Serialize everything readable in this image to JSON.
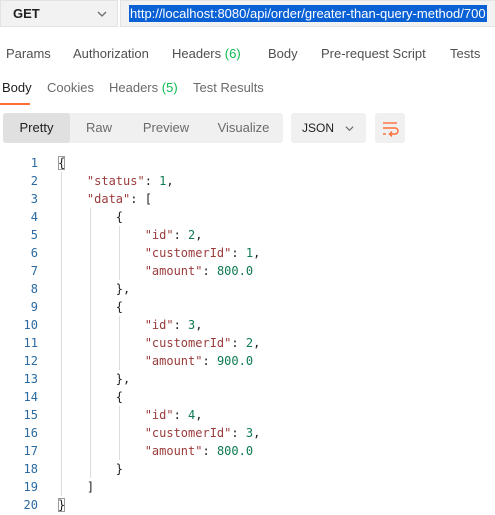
{
  "request": {
    "method": "GET",
    "url": "http://localhost:8080/api/order/greater-than-query-method/700"
  },
  "request_tabs": [
    {
      "label": "Params",
      "count": ""
    },
    {
      "label": "Authorization",
      "count": ""
    },
    {
      "label": "Headers",
      "count": "(6)"
    },
    {
      "label": "Body",
      "count": ""
    },
    {
      "label": "Pre-request Script",
      "count": ""
    },
    {
      "label": "Tests",
      "count": ""
    }
  ],
  "response_tabs": [
    {
      "label": "Body",
      "count": ""
    },
    {
      "label": "Cookies",
      "count": ""
    },
    {
      "label": "Headers",
      "count": "(5)"
    },
    {
      "label": "Test Results",
      "count": ""
    }
  ],
  "format_buttons": [
    "Pretty",
    "Raw",
    "Preview",
    "Visualize"
  ],
  "language": "JSON",
  "accent_color": "#ff6c37",
  "code_lines": [
    {
      "n": "1",
      "indent": 0,
      "parts": [
        [
          "punc",
          "{"
        ]
      ]
    },
    {
      "n": "2",
      "indent": 1,
      "parts": [
        [
          "key",
          "\"status\""
        ],
        [
          "punc",
          ": "
        ],
        [
          "num",
          "1"
        ],
        [
          "punc",
          ","
        ]
      ]
    },
    {
      "n": "3",
      "indent": 1,
      "parts": [
        [
          "key",
          "\"data\""
        ],
        [
          "punc",
          ": ["
        ]
      ]
    },
    {
      "n": "4",
      "indent": 2,
      "parts": [
        [
          "punc",
          "{"
        ]
      ]
    },
    {
      "n": "5",
      "indent": 3,
      "parts": [
        [
          "key",
          "\"id\""
        ],
        [
          "punc",
          ": "
        ],
        [
          "num",
          "2"
        ],
        [
          "punc",
          ","
        ]
      ]
    },
    {
      "n": "6",
      "indent": 3,
      "parts": [
        [
          "key",
          "\"customerId\""
        ],
        [
          "punc",
          ": "
        ],
        [
          "num",
          "1"
        ],
        [
          "punc",
          ","
        ]
      ]
    },
    {
      "n": "7",
      "indent": 3,
      "parts": [
        [
          "key",
          "\"amount\""
        ],
        [
          "punc",
          ": "
        ],
        [
          "num",
          "800.0"
        ]
      ]
    },
    {
      "n": "8",
      "indent": 2,
      "parts": [
        [
          "punc",
          "},"
        ]
      ]
    },
    {
      "n": "9",
      "indent": 2,
      "parts": [
        [
          "punc",
          "{"
        ]
      ]
    },
    {
      "n": "10",
      "indent": 3,
      "parts": [
        [
          "key",
          "\"id\""
        ],
        [
          "punc",
          ": "
        ],
        [
          "num",
          "3"
        ],
        [
          "punc",
          ","
        ]
      ]
    },
    {
      "n": "11",
      "indent": 3,
      "parts": [
        [
          "key",
          "\"customerId\""
        ],
        [
          "punc",
          ": "
        ],
        [
          "num",
          "2"
        ],
        [
          "punc",
          ","
        ]
      ]
    },
    {
      "n": "12",
      "indent": 3,
      "parts": [
        [
          "key",
          "\"amount\""
        ],
        [
          "punc",
          ": "
        ],
        [
          "num",
          "900.0"
        ]
      ]
    },
    {
      "n": "13",
      "indent": 2,
      "parts": [
        [
          "punc",
          "},"
        ]
      ]
    },
    {
      "n": "14",
      "indent": 2,
      "parts": [
        [
          "punc",
          "{"
        ]
      ]
    },
    {
      "n": "15",
      "indent": 3,
      "parts": [
        [
          "key",
          "\"id\""
        ],
        [
          "punc",
          ": "
        ],
        [
          "num",
          "4"
        ],
        [
          "punc",
          ","
        ]
      ]
    },
    {
      "n": "16",
      "indent": 3,
      "parts": [
        [
          "key",
          "\"customerId\""
        ],
        [
          "punc",
          ": "
        ],
        [
          "num",
          "3"
        ],
        [
          "punc",
          ","
        ]
      ]
    },
    {
      "n": "17",
      "indent": 3,
      "parts": [
        [
          "key",
          "\"amount\""
        ],
        [
          "punc",
          ": "
        ],
        [
          "num",
          "800.0"
        ]
      ]
    },
    {
      "n": "18",
      "indent": 2,
      "parts": [
        [
          "punc",
          "}"
        ]
      ]
    },
    {
      "n": "19",
      "indent": 1,
      "parts": [
        [
          "punc",
          "]"
        ]
      ]
    },
    {
      "n": "20",
      "indent": 0,
      "parts": [
        [
          "punc",
          "}"
        ]
      ]
    }
  ]
}
